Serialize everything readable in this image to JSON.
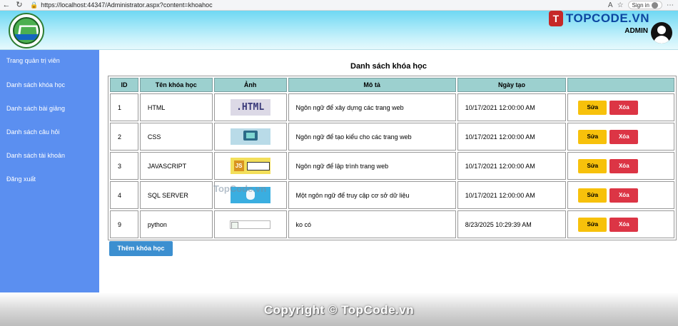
{
  "browser": {
    "url": "https://localhost:44347/Administrator.aspx?content=khoahoc",
    "signin_label": "Sign in"
  },
  "header": {
    "brand_mark": "T",
    "brand_text": "TOPCODE.VN",
    "admin_label": "ADMIN"
  },
  "sidebar": {
    "items": [
      {
        "label": "Trang quản trị viên"
      },
      {
        "label": "Danh sách khóa học"
      },
      {
        "label": "Danh sách bài giảng"
      },
      {
        "label": "Danh sách câu hỏi"
      },
      {
        "label": "Danh sách tài khoản"
      },
      {
        "label": "Đăng xuất"
      }
    ]
  },
  "main": {
    "title": "Danh sách khóa học",
    "columns": [
      "ID",
      "Tên khóa học",
      "Ảnh",
      "Mô tả",
      "Ngày tạo",
      ""
    ],
    "rows": [
      {
        "id": "1",
        "name": "HTML",
        "thumb": ".HTML",
        "desc": "Ngôn ngữ để xây dựng các trang web",
        "date": "10/17/2021 12:00:00 AM"
      },
      {
        "id": "2",
        "name": "CSS",
        "thumb": "",
        "desc": "Ngôn ngữ để tạo kiểu cho các trang web",
        "date": "10/17/2021 12:00:00 AM"
      },
      {
        "id": "3",
        "name": "JAVASCRIPT",
        "thumb": "",
        "desc": "Ngôn ngữ để lập trình trang web",
        "date": "10/17/2021 12:00:00 AM"
      },
      {
        "id": "4",
        "name": "SQL SERVER",
        "thumb": "",
        "desc": "Một ngôn ngữ để truy cập cơ sở dữ liệu",
        "date": "10/17/2021 12:00:00 AM"
      },
      {
        "id": "9",
        "name": "python",
        "thumb": "",
        "desc": "ko có",
        "date": "8/23/2025 10:29:39 AM"
      }
    ],
    "edit_label": "Sửa",
    "delete_label": "Xóa",
    "add_label": "Thêm khóa học"
  },
  "watermarks": {
    "center": "TopCode.vn",
    "footer": "Copyright © TopCode.vn"
  }
}
